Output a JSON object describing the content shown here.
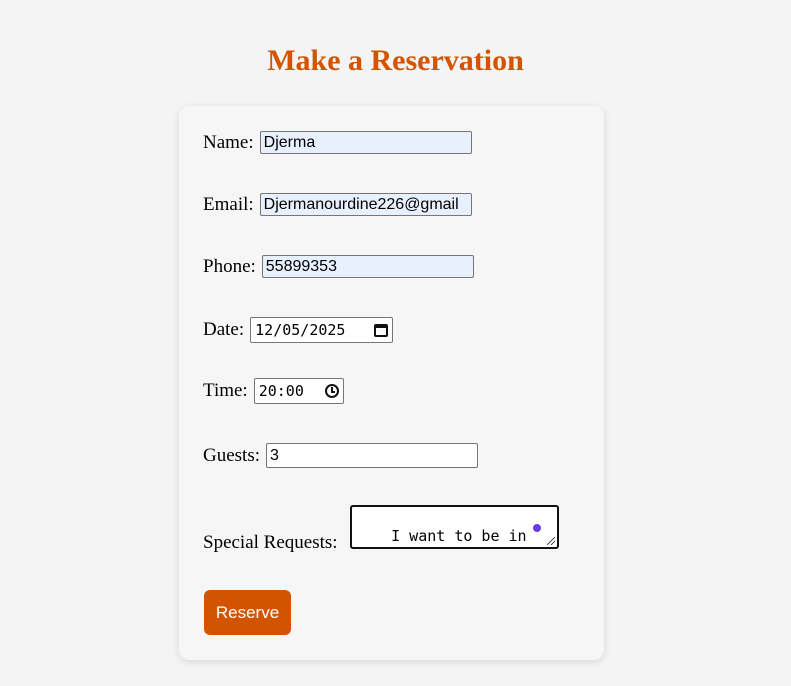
{
  "page": {
    "title": "Make a Reservation"
  },
  "form": {
    "name": {
      "label": "Name:",
      "value": "Djerma"
    },
    "email": {
      "label": "Email:",
      "value": "Djermanourdine226@gmail"
    },
    "phone": {
      "label": "Phone:",
      "value": "55899353"
    },
    "date": {
      "label": "Date:",
      "value": "12/05/2025",
      "icon": "calendar-icon"
    },
    "time": {
      "label": "Time:",
      "value": "20:00",
      "icon": "clock-icon"
    },
    "guests": {
      "label": "Guests:",
      "value": "3"
    },
    "special_requests": {
      "label": "Special Requests:",
      "value": "I want to be in the\nVIP"
    },
    "submit_label": "Reserve"
  },
  "colors": {
    "accent": "#d35400",
    "autofill": "#e8f0fe",
    "background": "#f4f4f4"
  }
}
